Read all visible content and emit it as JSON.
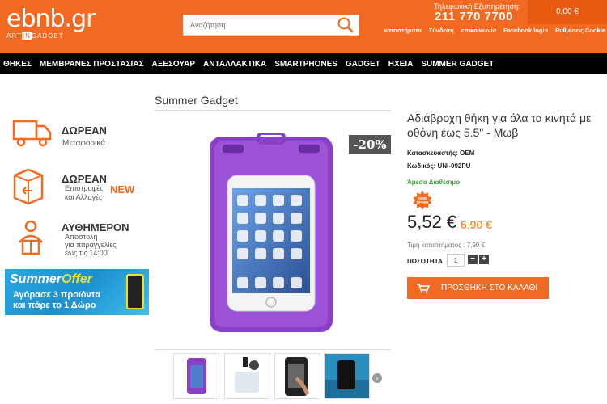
{
  "header": {
    "logo_main": "ebnb.gr",
    "logo_sub_a": "ART",
    "logo_sub_b": "IN",
    "logo_sub_c": "GADGET",
    "search_placeholder": "Αναζήτηση",
    "phone_label": "Τηλεφωνική Εξυπηρέτηση:",
    "phone_number": "211 770 7700",
    "cart_total": "0,00 €",
    "links": [
      "καταστήματα",
      "Σύνδεση",
      "επικοινωνία",
      "Facebook login",
      "Ρυθμίσεις Cookie"
    ]
  },
  "nav": [
    "ΘΗΚΕΣ",
    "ΜΕΜΒΡΑΝΕΣ ΠΡΟΣΤΑΣΙΑΣ",
    "ΑΞΕΣΟΥΑΡ",
    "ΑΝΤΑΛΛΑΚΤΙΚΑ",
    "SMARTPHONES",
    "GADGET",
    "ΗΧΕΙΑ",
    "SUMMER GADGET"
  ],
  "perks": {
    "shipping_title": "ΔΩΡΕΑΝ",
    "shipping_sub": "Μεταφορικά",
    "returns_title": "ΔΩΡΕΑΝ",
    "returns_sub_1": "Επιστροφές",
    "returns_sub_2": "και Αλλαγές",
    "new_badge": "NEW",
    "sameday_title": "ΑΥΘΗΜΕΡΟΝ",
    "sameday_sub_1": "Αποστολή",
    "sameday_sub_2": "για παραγγελίες",
    "sameday_sub_3": "έως τις 14:00"
  },
  "banner": {
    "title_a": "Summer",
    "title_b": "Offer",
    "line_1": "Αγόρασε 3 προϊόντα",
    "line_2": "και πάρε το 1 Δώρο"
  },
  "product": {
    "category": "Summer Gadget",
    "discount": "-20%",
    "title": "Αδιάβροχη θήκη για όλα τα κινητά με οθόνη έως 5.5\" - Μωβ",
    "manufacturer": "Κατασκευαστής: OEM",
    "code": "Κωδικός: UNI-092PU",
    "stock": "Άμεσα Διαθέσιμο",
    "web_offer": "WEB OFFER",
    "price": "5,52 €",
    "old_price": "6,90 €",
    "store_price": "Τιμή καταστήματος : 7,90 €",
    "qty_label": "ΠΟΣΟΤΗΤΑ",
    "qty_value": "1",
    "qty_minus": "−",
    "qty_plus": "+",
    "add_to_cart": "ΠΡΟΣΘΗΚΗ ΣΤΟ ΚΑΛΑΘΙ",
    "thumbs_next": "›"
  },
  "colors": {
    "brand": "#f26a21",
    "nav": "#000000",
    "in_stock": "#3aa43a",
    "product": "#8a3fc7"
  }
}
